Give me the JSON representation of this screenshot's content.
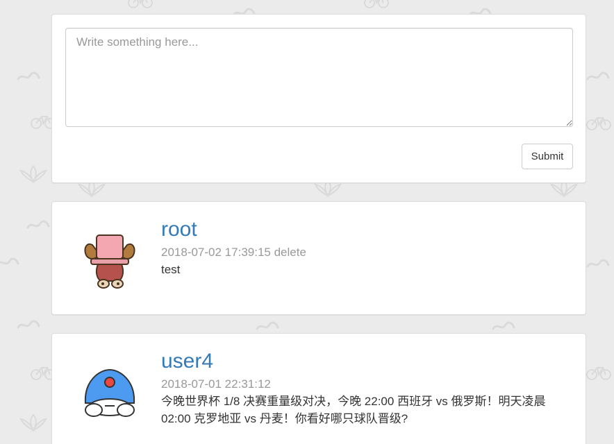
{
  "compose": {
    "placeholder": "Write something here...",
    "submit_label": "Submit"
  },
  "posts": [
    {
      "username": "root",
      "timestamp": "2018-07-02 17:39:15",
      "delete_label": "delete",
      "content": "test",
      "avatar_icon": "chopper-avatar-icon"
    },
    {
      "username": "user4",
      "timestamp": "2018-07-01 22:31:12",
      "content": "今晚世界杯 1/8 决赛重量级对决，今晚 22:00 西班牙 vs 俄罗斯！明天凌晨 02:00 克罗地亚 vs 丹麦！你看好哪只球队晋级?",
      "avatar_icon": "doraemon-avatar-icon"
    }
  ],
  "colors": {
    "background": "#ebebeb",
    "link": "#337ab7",
    "meta": "#999999",
    "text": "#333333"
  }
}
